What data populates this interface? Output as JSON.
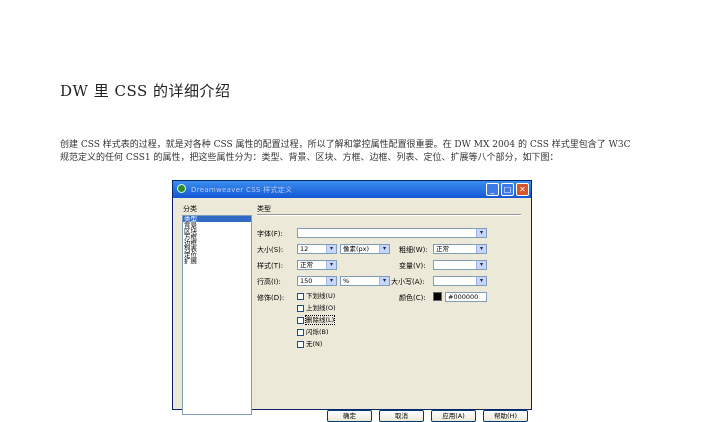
{
  "document": {
    "title": "DW 里 CSS 的详细介绍",
    "paragraph_line1": "创建 CSS 样式表的过程，就是对各种 CSS 属性的配置过程，所以了解和掌控属性配置很重要。在 DW MX 2004 的 CSS 样式里包含了 W3C",
    "paragraph_line2": "规范定义的任何 CSS1 的属性，把这些属性分为：类型、背景、区块、方框、边框、列表、定位、扩展等八个部分，如下图："
  },
  "dialog": {
    "title": "Dreamweaver CSS 样式定义",
    "window_buttons": {
      "minimize": "_",
      "maximize": "□",
      "close": "✕"
    },
    "category_header": "分类",
    "type_header": "类型",
    "categories": [
      "类型",
      "背景",
      "区块",
      "方框",
      "边框",
      "列表",
      "定位",
      "扩展"
    ],
    "selected_category": "类型",
    "fields": {
      "font_label": "字体(F):",
      "font_value": "",
      "size_label": "大小(S):",
      "size_value": "12",
      "size_unit": "像素(px)",
      "weight_label": "粗细(W):",
      "weight_value": "正常",
      "style_label": "样式(T):",
      "style_value": "正常",
      "variant_label": "变量(V):",
      "variant_value": "",
      "lineheight_label": "行高(I):",
      "lineheight_value": "150",
      "lineheight_unit": "%",
      "case_label": "大小写(A):",
      "case_value": "",
      "decoration_label": "修饰(D):",
      "color_label": "颜色(C):",
      "color_value": "#000000"
    },
    "decorations": [
      {
        "label": "下划线(U)",
        "checked": false
      },
      {
        "label": "上划线(O)",
        "checked": false
      },
      {
        "label": "删除线(L)",
        "checked": false
      },
      {
        "label": "闪烁(B)",
        "checked": false
      },
      {
        "label": "无(N)",
        "checked": false
      }
    ],
    "buttons": {
      "ok": "确定",
      "cancel": "取消",
      "apply": "应用(A)",
      "help": "帮助(H)"
    },
    "dropdown_arrow": "▾"
  }
}
